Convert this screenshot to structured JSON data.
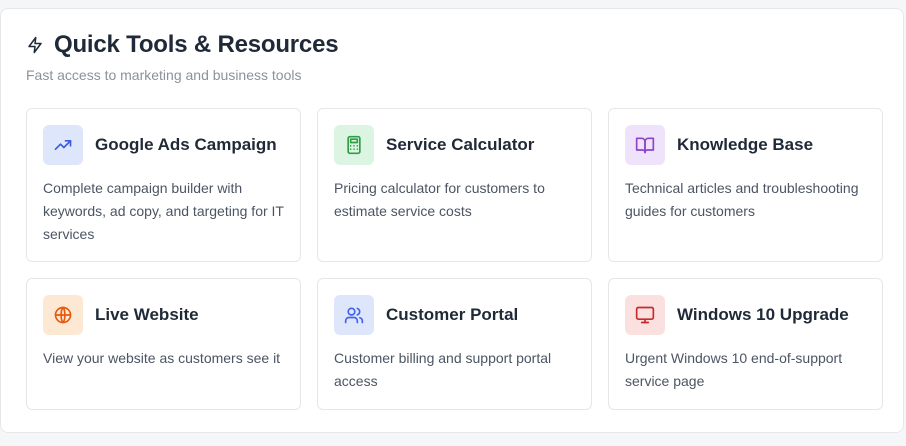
{
  "header": {
    "title": "Quick Tools & Resources",
    "subtitle": "Fast access to marketing and business tools",
    "icon": "lightning-icon"
  },
  "tools": [
    {
      "title": "Google Ads Campaign",
      "description": "Complete campaign builder with keywords, ad copy, and targeting for IT services",
      "icon": "trending-up-icon",
      "icon_color": "#3b5bdb",
      "icon_bg": "#dde6fb"
    },
    {
      "title": "Service Calculator",
      "description": "Pricing calculator for customers to estimate service costs",
      "icon": "calculator-icon",
      "icon_color": "#2f9e44",
      "icon_bg": "#dcf5e3"
    },
    {
      "title": "Knowledge Base",
      "description": "Technical articles and troubleshooting guides for customers",
      "icon": "book-open-icon",
      "icon_color": "#8e44c9",
      "icon_bg": "#efe3fb"
    },
    {
      "title": "Live Website",
      "description": "View your website as customers see it",
      "icon": "globe-icon",
      "icon_color": "#e8590c",
      "icon_bg": "#fde8d4"
    },
    {
      "title": "Customer Portal",
      "description": "Customer billing and support portal access",
      "icon": "users-icon",
      "icon_color": "#4263eb",
      "icon_bg": "#dde6fb"
    },
    {
      "title": "Windows 10 Upgrade",
      "description": "Urgent Windows 10 end-of-support service page",
      "icon": "monitor-icon",
      "icon_color": "#c92a2a",
      "icon_bg": "#fbe0e0"
    }
  ]
}
